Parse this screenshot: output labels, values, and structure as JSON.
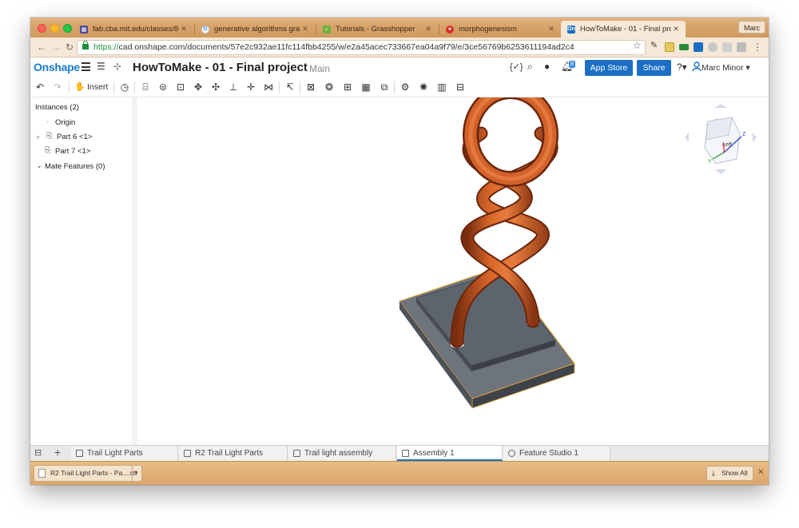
{
  "browser": {
    "tabs": [
      {
        "title": "fab.cba.mit.edu/classes/863.",
        "favicon": "grid",
        "active": false
      },
      {
        "title": "generative algorithms grassho",
        "favicon": "google",
        "active": false
      },
      {
        "title": "Tutorials - Grasshopper",
        "favicon": "grasshopper",
        "active": false
      },
      {
        "title": "morphogenesism",
        "favicon": "red-circle",
        "active": false
      },
      {
        "title": "HowToMake - 01 - Final projec",
        "favicon": "onshape",
        "active": true
      }
    ],
    "profile": "Marc",
    "url_protocol": "https://",
    "url_rest": "cad.onshape.com/documents/57e2c932ae11fc114fbb4255/w/e2a45acec733667ea04a9f79/e/3ce56769b6253611194ad2c4"
  },
  "onshape": {
    "logo": "Onshape",
    "document_title": "HowToMake - 01 - Final project",
    "branch": "Main",
    "app_store_label": "App Store",
    "share_label": "Share",
    "notification_count": "8",
    "user_name": "Marc Minor"
  },
  "toolbar": {
    "insert_label": "Insert"
  },
  "instances": {
    "header": "Instances (2)",
    "items": [
      {
        "label": "Origin"
      },
      {
        "label": "Part 6 <1>"
      },
      {
        "label": "Part 7 <1>"
      },
      {
        "label": "Mate Features (0)"
      }
    ]
  },
  "view_cube": {
    "face_label": "Left",
    "axes": [
      "X",
      "Y",
      "Z"
    ],
    "colors": {
      "x": "#d22",
      "y": "#1a9a2a",
      "z": "#2a3ad0"
    }
  },
  "model": {
    "tube_color": "#c85a22",
    "base_color": "#5d646d",
    "selection_color": "#f2a93a"
  },
  "bottom_tabs": [
    {
      "label": "Trail Light Parts",
      "active": false
    },
    {
      "label": "R2 Trail Light Parts",
      "active": false
    },
    {
      "label": "Trail light assembly",
      "active": false
    },
    {
      "label": "Assembly 1",
      "active": true
    },
    {
      "label": "Feature Studio 1",
      "active": false
    }
  ],
  "downloads": {
    "file_label": "R2 Trail Light Parts - Pa....stl",
    "show_all_label": "Show All"
  }
}
